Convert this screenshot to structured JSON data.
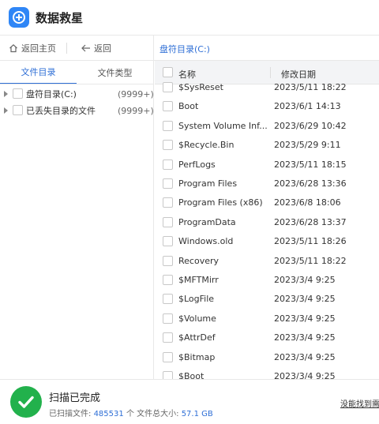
{
  "app": {
    "title": "数据救星",
    "logo_icon": "plus-circle-icon",
    "accent_color": "#2f86f6"
  },
  "nav": {
    "home_label": "返回主页",
    "back_label": "返回",
    "path": "盘符目录(C:)"
  },
  "left_panel": {
    "tabs": [
      {
        "label": "文件目录",
        "active": true
      },
      {
        "label": "文件类型",
        "active": false
      }
    ],
    "tree": [
      {
        "label": "盘符目录(C:)",
        "count": "(9999+)"
      },
      {
        "label": "已丢失目录的文件",
        "count": "(9999+)"
      }
    ]
  },
  "table": {
    "columns": [
      "名称",
      "修改日期"
    ],
    "rows": [
      {
        "name": "$SysReset",
        "date": "2023/5/11 18:22"
      },
      {
        "name": "Boot",
        "date": "2023/6/1 14:13"
      },
      {
        "name": "System Volume Inf...",
        "date": "2023/6/29 10:42"
      },
      {
        "name": "$Recycle.Bin",
        "date": "2023/5/29 9:11"
      },
      {
        "name": "PerfLogs",
        "date": "2023/5/11 18:15"
      },
      {
        "name": "Program Files",
        "date": "2023/6/28 13:36"
      },
      {
        "name": "Program Files (x86)",
        "date": "2023/6/8 18:06"
      },
      {
        "name": "ProgramData",
        "date": "2023/6/28 13:37"
      },
      {
        "name": "Windows.old",
        "date": "2023/5/11 18:26"
      },
      {
        "name": "Recovery",
        "date": "2023/5/11 18:22"
      },
      {
        "name": "$MFTMirr",
        "date": "2023/3/4 9:25"
      },
      {
        "name": "$LogFile",
        "date": "2023/3/4 9:25"
      },
      {
        "name": "$Volume",
        "date": "2023/3/4 9:25"
      },
      {
        "name": "$AttrDef",
        "date": "2023/3/4 9:25"
      },
      {
        "name": "$Bitmap",
        "date": "2023/3/4 9:25"
      },
      {
        "name": "$Boot",
        "date": "2023/3/4 9:25"
      }
    ]
  },
  "footer": {
    "status_title": "扫描已完成",
    "scanned_label": "已扫描文件:",
    "scanned_count": "485531",
    "unit": "个",
    "total_size_label": "文件总大小:",
    "total_size": "57.1 GB",
    "not_found_link": "没能找到需",
    "status_color": "#22b14c"
  }
}
